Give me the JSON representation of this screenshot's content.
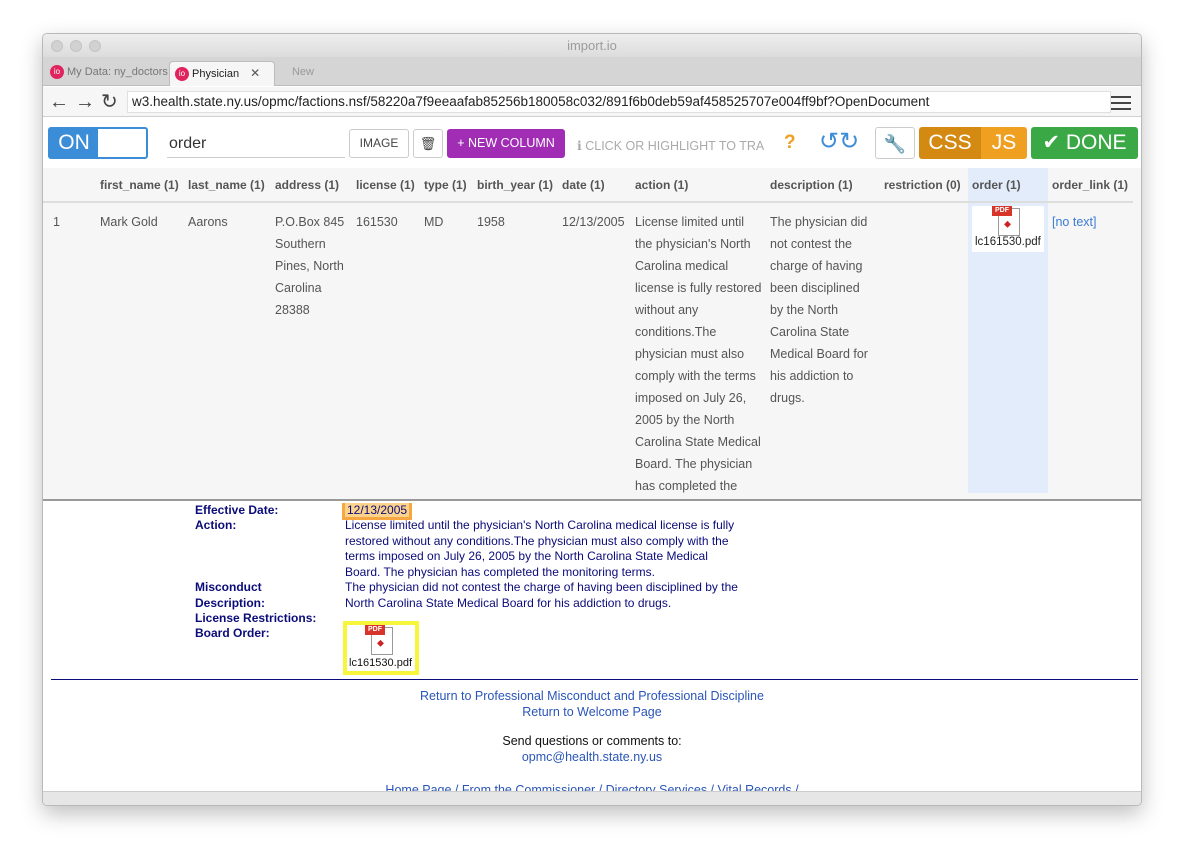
{
  "window": {
    "title": "import.io"
  },
  "tabs": [
    {
      "label": "My Data: ny_doctors"
    },
    {
      "label": "Physician"
    },
    {
      "label": "New"
    }
  ],
  "address": {
    "url": "w3.health.state.ny.us/opmc/factions.nsf/58220a7f9eeaafab85256b180058c032/891f6b0deb59af458525707e004ff9bf?OpenDocument"
  },
  "toolbar": {
    "toggle_label": "ON",
    "column_name": "order",
    "image_label": "IMAGE",
    "new_column_label": "+ NEW COLUMN",
    "hint": "CLICK OR HIGHLIGHT TO TRA",
    "help_label": "?",
    "css_label": "CSS",
    "js_label": "JS",
    "done_label": "DONE",
    "colors": {
      "toggle": "#3c8dd8",
      "new_column": "#a12db5",
      "css": "#d48a12",
      "js": "#f0a020",
      "done": "#3aa845"
    }
  },
  "table": {
    "headers": [
      "first_name (1)",
      "last_name (1)",
      "address (1)",
      "license (1)",
      "type (1)",
      "birth_year (1)",
      "date (1)",
      "action (1)",
      "description (1)",
      "restriction (0)",
      "order (1)",
      "order_link (1)"
    ],
    "row": {
      "index": "1",
      "first_name": "Mark Gold",
      "last_name": "Aarons",
      "address_lines": [
        "P.O.Box 845",
        "Southern",
        "Pines, North",
        "Carolina",
        "28388"
      ],
      "license": "161530",
      "type": "MD",
      "birth_year": "1958",
      "date": "12/13/2005",
      "action_lines": [
        "License limited until",
        "the physician's North",
        "Carolina medical",
        "license is fully restored",
        "without any",
        "conditions.The",
        "physician must also",
        "comply with the terms",
        "imposed on July 26,",
        "2005 by the North",
        "Carolina State Medical",
        "Board. The physician",
        "has completed the"
      ],
      "description_lines": [
        "The physician did",
        "not contest the",
        "charge of having",
        "been disciplined",
        "by the North",
        "Carolina State",
        "Medical Board for",
        "his addiction to",
        "drugs."
      ],
      "order_file": "lc161530.pdf",
      "order_link": "[no text]"
    }
  },
  "page": {
    "effective_date_label": "Effective Date:",
    "effective_date": "12/13/2005",
    "action_label": "Action:",
    "action_lines": [
      "License limited until the physician's North Carolina medical license is fully",
      "restored without any conditions.The physician must also comply with the",
      "terms imposed on July 26, 2005 by the North Carolina State Medical",
      "Board. The physician has completed the monitoring terms."
    ],
    "misconduct_label_1": "Misconduct",
    "misconduct_label_2": "Description:",
    "misconduct_lines": [
      "The physician did not contest the charge of having been disciplined by the",
      "North Carolina State Medical Board for his addiction to drugs."
    ],
    "license_restrictions_label": "License Restrictions:",
    "board_order_label": "Board Order:",
    "board_order_file": "lc161530.pdf",
    "pdf_badge": "PDF",
    "pdf_brand": "Adobe",
    "link_misconduct": "Return to Professional Misconduct and Professional Discipline",
    "link_welcome": "Return to Welcome Page",
    "send_text": "Send questions or comments to:",
    "email": "opmc@health.state.ny.us",
    "footer_links": [
      "Home Page",
      "From the Commissioner",
      "Directory Services",
      "Vital Records"
    ]
  }
}
